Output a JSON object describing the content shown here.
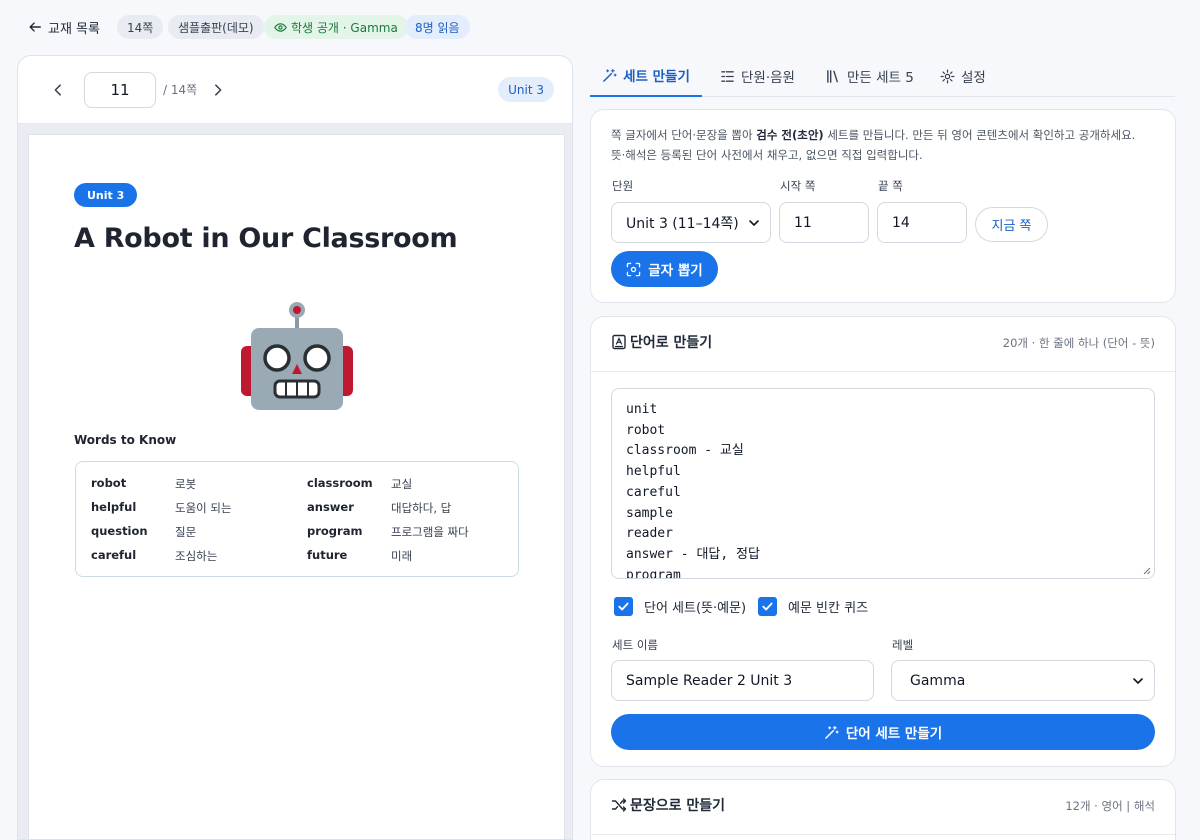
{
  "topbar": {
    "back_label": "교재 목록",
    "chips": [
      "14쪽",
      "샘플출판(데모)",
      "학생 공개 · Gamma",
      "8명 읽음"
    ]
  },
  "viewer": {
    "current_page": "11",
    "total_pages": "/ 14쪽",
    "unit_badge": "Unit 3"
  },
  "paper": {
    "unit": "Unit 3",
    "title": "A Robot in Our Classroom",
    "words_heading": "Words to Know",
    "vocab": [
      {
        "word": "robot",
        "meaning": "로봇"
      },
      {
        "word": "classroom",
        "meaning": "교실"
      },
      {
        "word": "helpful",
        "meaning": "도움이 되는"
      },
      {
        "word": "answer",
        "meaning": "대답하다, 답"
      },
      {
        "word": "question",
        "meaning": "질문"
      },
      {
        "word": "program",
        "meaning": "프로그램을 짜다"
      },
      {
        "word": "careful",
        "meaning": "조심하는"
      },
      {
        "word": "future",
        "meaning": "미래"
      }
    ]
  },
  "tabs": [
    {
      "label": "세트 만들기",
      "icon": "magic-wand-icon"
    },
    {
      "label": "단원·음원",
      "icon": "list-icon"
    },
    {
      "label": "만든 세트 5",
      "icon": "books-icon"
    },
    {
      "label": "설정",
      "icon": "gear-icon"
    }
  ],
  "extract": {
    "desc_1": "쪽 글자에서 단어·문장을 뽑아 ",
    "desc_bold": "검수 전(초안)",
    "desc_2": " 세트를 만듭니다. 만든 뒤 영어 콘텐츠에서 확인하고 공개하세요.",
    "desc_3": "뜻·해석은 등록된 단어 사전에서 채우고, 없으면 직접 입력합니다.",
    "unit_label": "단원",
    "unit_value": "Unit 3 (11–14쪽)",
    "start_label": "시작 쪽",
    "start_value": "11",
    "end_label": "끝 쪽",
    "end_value": "14",
    "now_button": "지금 쪽",
    "extract_button": "글자 뽑기"
  },
  "words": {
    "title": "단어로 만들기",
    "meta": "20개 · 한 줄에 하나 (단어 - 뜻)",
    "lines": [
      "unit",
      "robot",
      "classroom - 교실",
      "helpful",
      "careful",
      "sample",
      "reader",
      "answer - 대답, 정답",
      "program"
    ],
    "check_word_set": "단어 세트(뜻·예문)",
    "check_quiz": "예문 빈칸 퀴즈",
    "set_name_label": "세트 이름",
    "set_name_value": "Sample Reader 2 Unit 3",
    "level_label": "레벨",
    "level_value": "Gamma",
    "make_button": "단어 세트 만들기"
  },
  "sentences": {
    "title": "문장으로 만들기",
    "meta": "12개 · 영어 | 해석"
  }
}
